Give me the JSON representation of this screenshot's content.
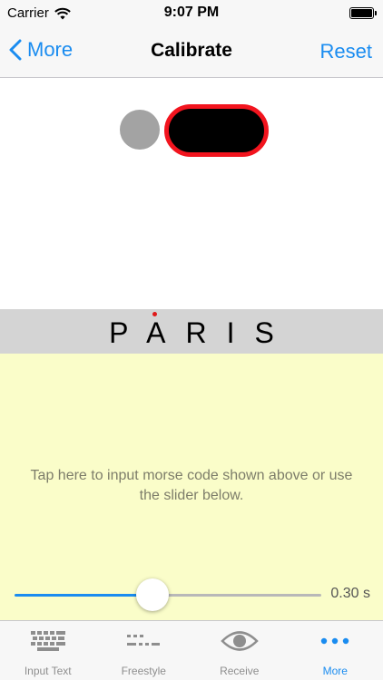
{
  "status_bar": {
    "carrier": "Carrier",
    "time": "9:07 PM"
  },
  "nav": {
    "back_label": "More",
    "title": "Calibrate",
    "reset_label": "Reset"
  },
  "morse": {
    "symbols": [
      "dot",
      "dash"
    ],
    "dot_color": "#a3a3a3",
    "dash_color": "#000000",
    "dash_highlight_color": "#f2141e"
  },
  "word": {
    "text": "PARIS",
    "marker_color": "#e01818"
  },
  "input_area": {
    "instruction": "Tap here to input morse code shown above or use the slider below.",
    "background": "#fafdc9"
  },
  "slider": {
    "value_label": "0.30 s",
    "fraction": 0.45
  },
  "tabs": [
    {
      "label": "Input Text",
      "icon": "keyboard-icon",
      "active": false
    },
    {
      "label": "Freestyle",
      "icon": "morse-dots-icon",
      "active": false
    },
    {
      "label": "Receive",
      "icon": "eye-icon",
      "active": false
    },
    {
      "label": "More",
      "icon": "more-dots-icon",
      "active": true
    }
  ],
  "colors": {
    "accent": "#1a8cf0"
  }
}
